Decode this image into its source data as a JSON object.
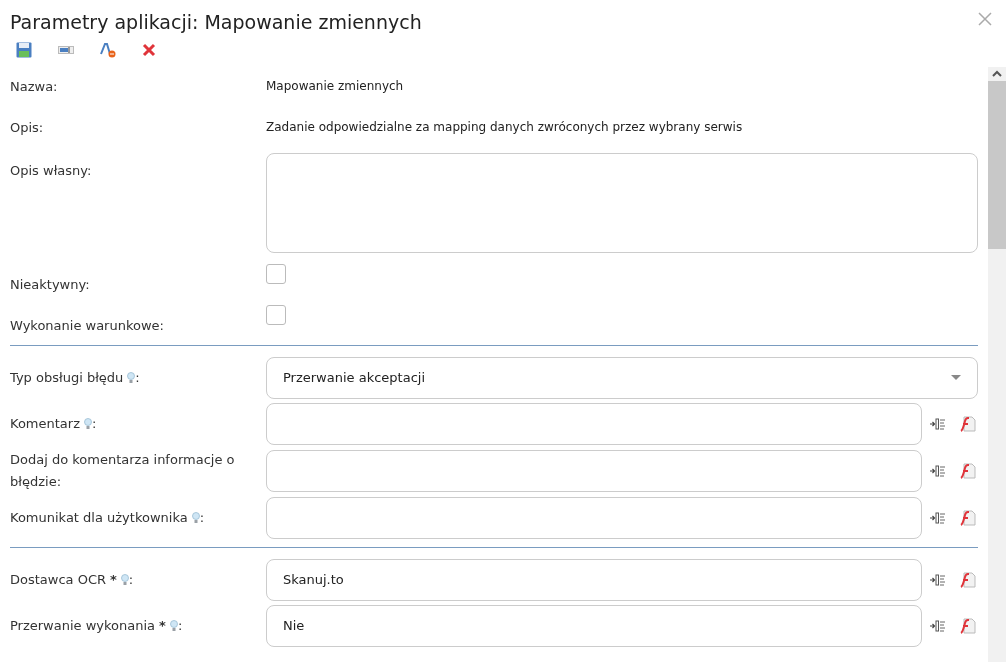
{
  "window": {
    "title": "Parametry aplikacji: Mapowanie zmiennych"
  },
  "sections": [
    {
      "rows": [
        {
          "kind": "text",
          "label": "Nazwa:",
          "value": "Mapowanie zmiennych"
        },
        {
          "kind": "text",
          "label": "Opis:",
          "value": "Zadanie odpowiedzialne za mapping danych zwróconych przez wybrany serwis"
        },
        {
          "kind": "textarea",
          "label": "Opis własny:",
          "value": ""
        },
        {
          "kind": "checkbox",
          "label": "Nieaktywny:",
          "checked": false
        },
        {
          "kind": "checkbox",
          "label": "Wykonanie warunkowe:",
          "checked": false
        }
      ]
    },
    {
      "rows": [
        {
          "kind": "select",
          "label": "Typ obsługi błędu",
          "hint": true,
          "suffix": ":",
          "value": "Przerwanie akceptacji"
        },
        {
          "kind": "input",
          "label": "Komentarz",
          "hint": true,
          "suffix": ":",
          "value": ""
        },
        {
          "kind": "input",
          "label": "Dodaj do komentarza informacje o błędzie:",
          "hint": false,
          "value": ""
        },
        {
          "kind": "input",
          "label": "Komunikat dla użytkownika",
          "hint": true,
          "suffix": ":",
          "value": ""
        }
      ]
    },
    {
      "rows": [
        {
          "kind": "input",
          "label": "Dostawca OCR",
          "required": "*",
          "hint": true,
          "suffix": ":",
          "value": "Skanuj.to"
        },
        {
          "kind": "input",
          "label": "Przerwanie wykonania",
          "required": "*",
          "hint": true,
          "suffix": ":",
          "value": "Nie"
        }
      ]
    }
  ]
}
